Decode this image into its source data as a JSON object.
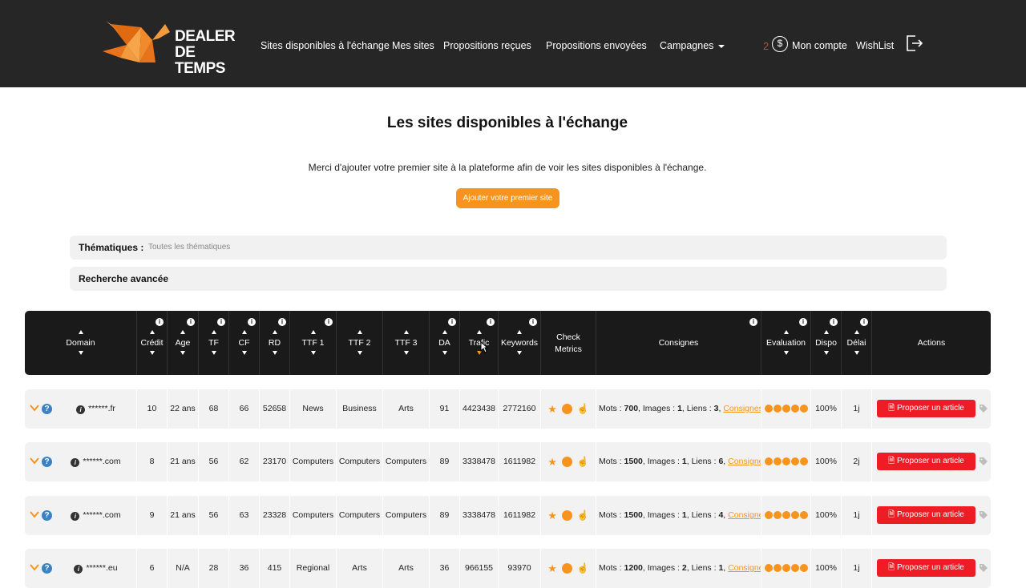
{
  "header": {
    "logo_line1": "DEALER",
    "logo_line2": "DE TEMPS",
    "nav": [
      {
        "label": "Sites disponibles à l'échange"
      },
      {
        "label": "Mes sites"
      },
      {
        "label": "Propositions reçues"
      },
      {
        "label": "Propositions envoyées"
      },
      {
        "label": "Campagnes"
      }
    ],
    "credits": "2",
    "account": "Mon compte",
    "wishlist": "WishList"
  },
  "page": {
    "title": "Les sites disponibles à l'échange",
    "notice": "Merci d'ajouter votre premier site à la plateforme afin de voir les sites disponibles à l'échange.",
    "add_site_button": "Ajouter votre premier site"
  },
  "filters": {
    "thematiques_label": "Thématiques :",
    "thematiques_value": "Toutes les thématiques",
    "advanced_search": "Recherche avancée"
  },
  "table": {
    "columns": {
      "domain": "Domain",
      "credit": "Crédit",
      "age": "Age",
      "tf": "TF",
      "cf": "CF",
      "rd": "RD",
      "ttf1": "TTF 1",
      "ttf2": "TTF 2",
      "ttf3": "TTF 3",
      "da": "DA",
      "trafic": "Trafic",
      "keywords": "Keywords",
      "check_metrics_1": "Check",
      "check_metrics_2": "Metrics",
      "consignes": "Consignes",
      "evaluation": "Evaluation",
      "dispo": "Dispo",
      "delai": "Délai",
      "actions": "Actions"
    },
    "propose_label": "Proposer un article",
    "consignes_link": "Consignes",
    "rows": [
      {
        "domain": "******.fr",
        "credit": "10",
        "age": "22 ans",
        "tf": "68",
        "cf": "66",
        "rd": "52658",
        "ttf1": "News",
        "ttf2": "Business",
        "ttf3": "Arts",
        "da": "91",
        "trafic": "4423438",
        "keywords": "2772160",
        "mots": "700",
        "images": "1",
        "liens": "3",
        "dispo": "100%",
        "delai": "1j"
      },
      {
        "domain": "******.com",
        "credit": "8",
        "age": "21 ans",
        "tf": "56",
        "cf": "62",
        "rd": "23170",
        "ttf1": "Computers",
        "ttf2": "Computers",
        "ttf3": "Computers",
        "da": "89",
        "trafic": "3338478",
        "keywords": "1611982",
        "mots": "1500",
        "images": "1",
        "liens": "6",
        "dispo": "100%",
        "delai": "2j"
      },
      {
        "domain": "******.com",
        "credit": "9",
        "age": "21 ans",
        "tf": "56",
        "cf": "63",
        "rd": "23328",
        "ttf1": "Computers",
        "ttf2": "Computers",
        "ttf3": "Computers",
        "da": "89",
        "trafic": "3338478",
        "keywords": "1611982",
        "mots": "1500",
        "images": "1",
        "liens": "4",
        "dispo": "100%",
        "delai": "1j"
      },
      {
        "domain": "******.eu",
        "credit": "6",
        "age": "N/A",
        "tf": "28",
        "cf": "36",
        "rd": "415",
        "ttf1": "Regional",
        "ttf2": "Arts",
        "ttf3": "Arts",
        "da": "36",
        "trafic": "966155",
        "keywords": "93970",
        "mots": "1200",
        "images": "2",
        "liens": "1",
        "dispo": "100%",
        "delai": "1j"
      }
    ]
  },
  "colors": {
    "accent": "#f7941d",
    "danger": "#ee1c25",
    "header_bg": "#262626",
    "help_blue": "#3b82c4"
  }
}
